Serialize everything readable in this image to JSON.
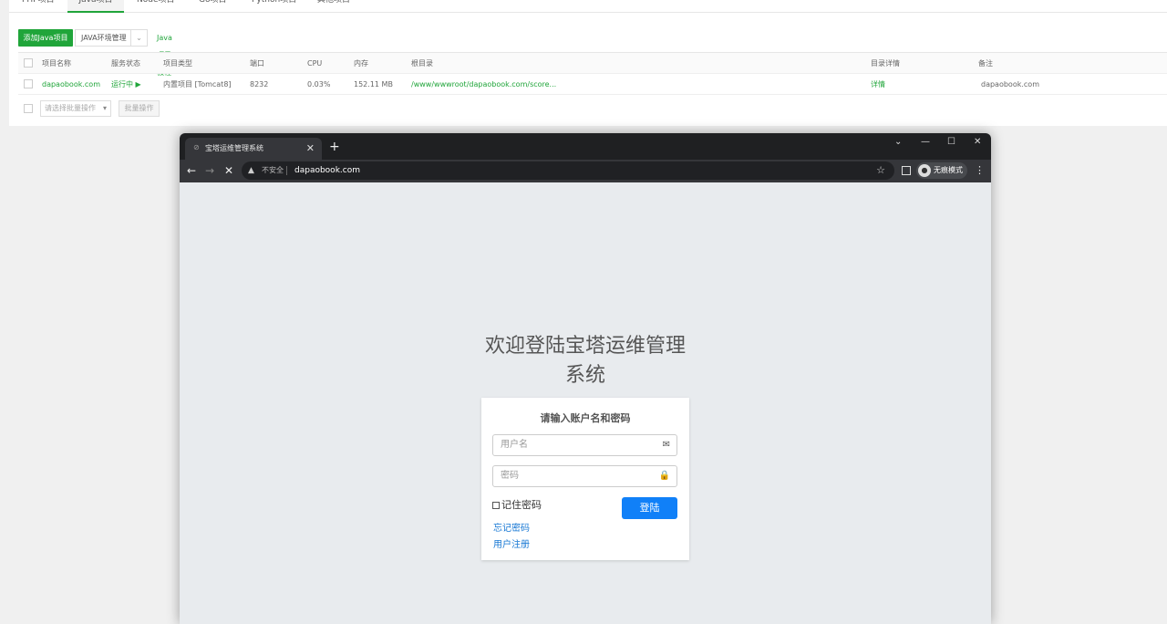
{
  "panel": {
    "tabs": [
      "PHP项目",
      "Java项目",
      "Node项目",
      "Go项目",
      "Python项目",
      "其他项目"
    ],
    "active_tab": "Java项目",
    "add_button": "添加Java项目",
    "env_button": "JAVA环境管理",
    "tutorial_link": "Java项目教程",
    "table": {
      "headers": [
        "项目名称",
        "服务状态",
        "项目类型",
        "端口",
        "CPU",
        "内存",
        "根目录",
        "目录详情",
        "备注"
      ],
      "rows": [
        {
          "name": "dapaobook.com",
          "status": "运行中 ▶",
          "type": "内置项目 [Tomcat8]",
          "port": "8232",
          "cpu": "0.03%",
          "memory": "152.11 MB",
          "root": "/www/wwwroot/dapaobook.com/score...",
          "details": "详情",
          "note": "dapaobook.com"
        }
      ]
    },
    "batch_placeholder": "请选择批量操作",
    "batch_button": "批量操作"
  },
  "browser": {
    "tab_title": "宝塔运维管理系统",
    "insecure_label": "不安全",
    "url": "dapaobook.com",
    "incognito_label": "无痕模式"
  },
  "login": {
    "welcome_line1": "欢迎登陆宝塔运维管理",
    "welcome_line2": "系统",
    "card_title": "请输入账户名和密码",
    "username_placeholder": "用户名",
    "password_placeholder": "密码",
    "remember_label": "记住密码",
    "login_button": "登陆",
    "forgot_link": "忘记密码",
    "register_link": "用户注册"
  },
  "colors": {
    "bt_green": "#20a53a",
    "login_blue": "#1080f8",
    "link_blue": "#1677d4",
    "page_bg": "#e8ebee"
  }
}
